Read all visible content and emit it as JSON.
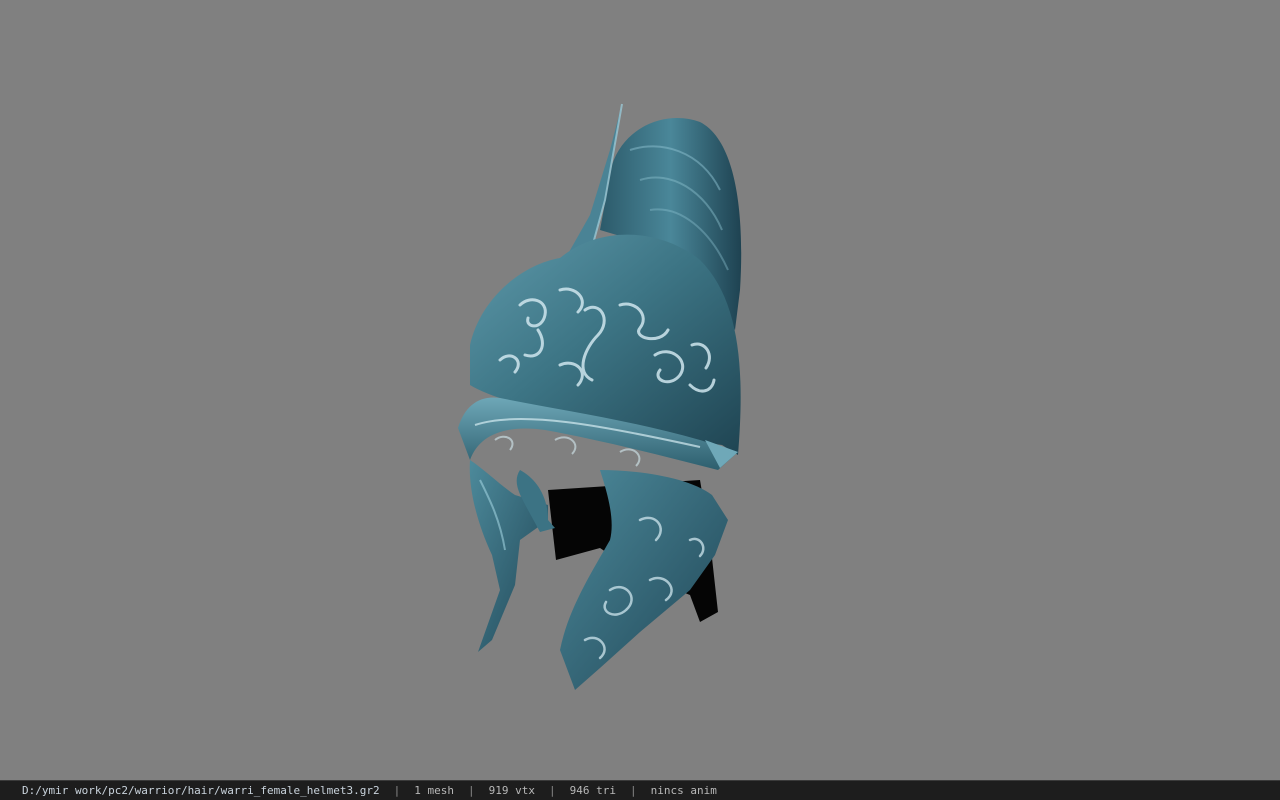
{
  "viewer": {
    "background_color": "#808080",
    "model_icon": "helmet-model"
  },
  "statusbar": {
    "path": "D:/ymir work/pc2/warrior/hair/warri_female_helmet3.gr2",
    "separator": "|",
    "meshes": "1 mesh",
    "vertices": "919 vtx",
    "triangles": "946 tri",
    "animation": "nincs anim"
  },
  "colors": {
    "metal_dark": "#1f4452",
    "metal_mid": "#3f7888",
    "metal_light": "#7fb4c4",
    "engraving": "#cfe6ee",
    "statusbar_bg": "#1d1d1d"
  }
}
